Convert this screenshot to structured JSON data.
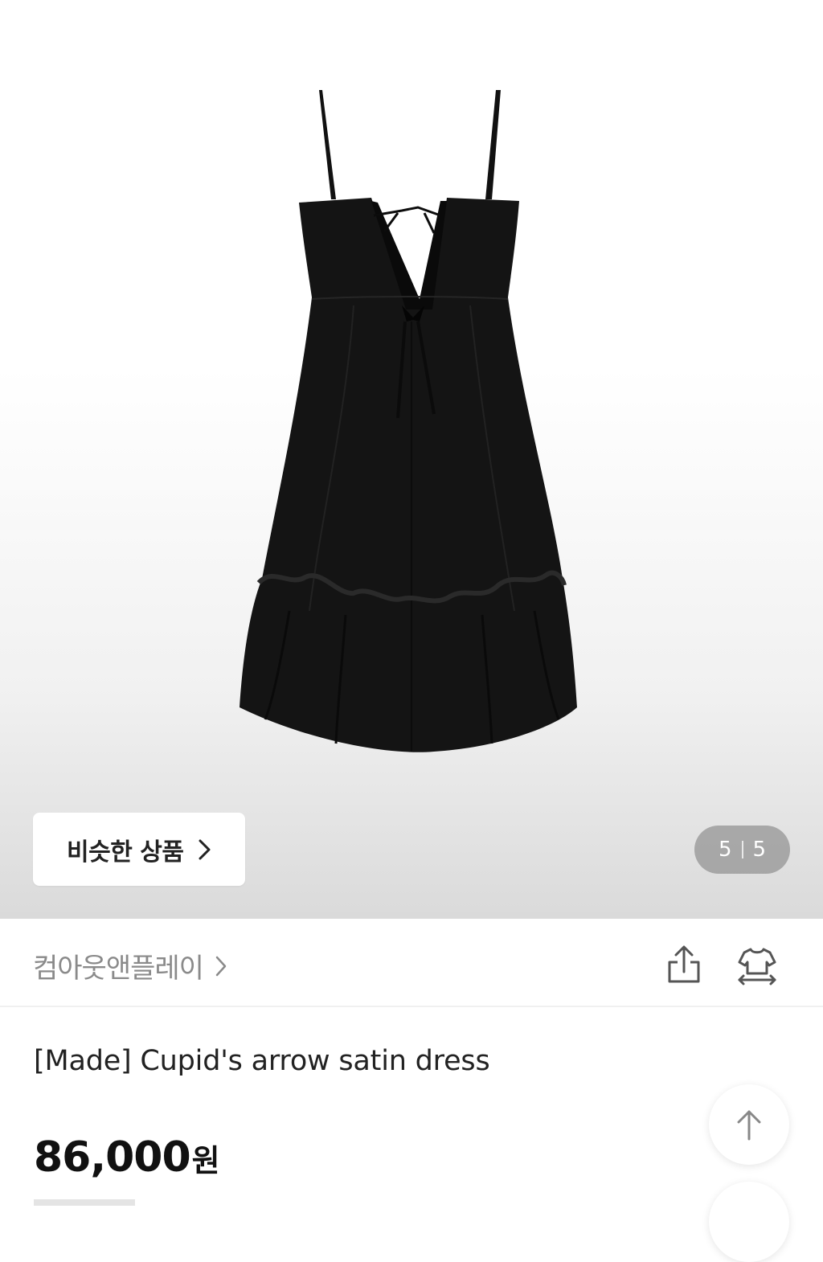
{
  "gallery": {
    "image_alt": "black satin dress back view",
    "similar_button_label": "비슷한 상품",
    "counter_current": "5",
    "counter_total": "5"
  },
  "brand": {
    "name": "컴아웃앤플레이",
    "share_icon": "share-icon",
    "fitting_icon": "size-fit-icon"
  },
  "product": {
    "title": "[Made] Cupid's arrow satin dress",
    "price": "86,000",
    "currency": "원"
  },
  "floating": {
    "scroll_top_icon": "arrow-up-icon"
  }
}
